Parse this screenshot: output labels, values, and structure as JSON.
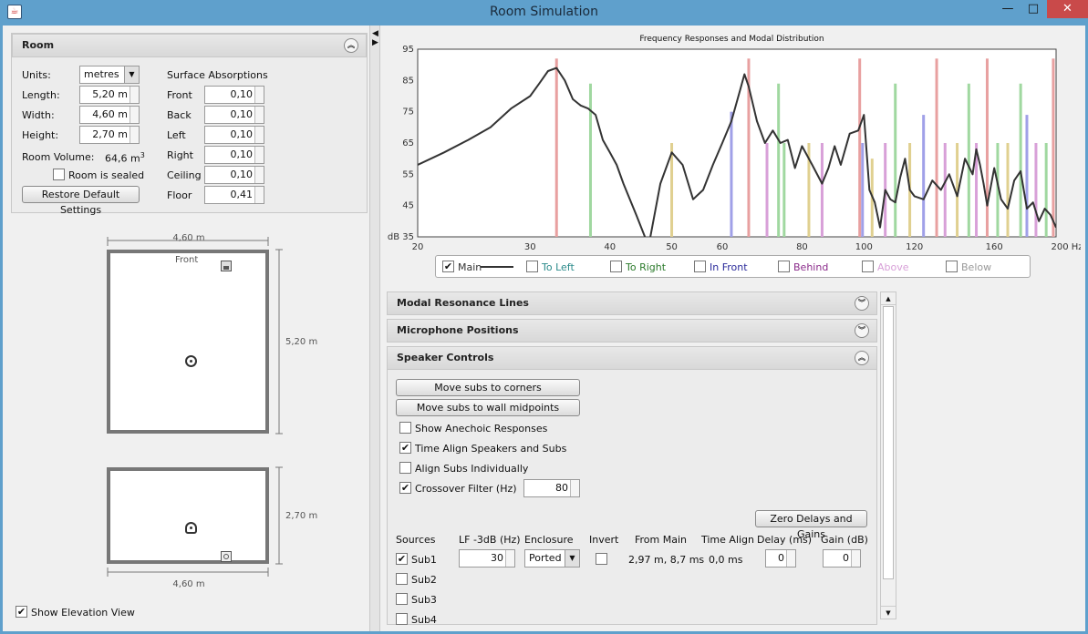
{
  "window": {
    "title": "Room Simulation",
    "minimize": "—",
    "maximize": "□",
    "close": "✕",
    "app_icon": "java-cup-icon"
  },
  "room": {
    "header": "Room",
    "units_label": "Units:",
    "units_value": "metres",
    "length_label": "Length:",
    "length_value": "5,20 m",
    "width_label": "Width:",
    "width_value": "4,60 m",
    "height_label": "Height:",
    "height_value": "2,70 m",
    "volume_label": "Room Volume:",
    "volume_value": "64,6 m",
    "volume_unit_sup": "3",
    "sealed_label": "Room is sealed",
    "sealed_checked": false,
    "restore_button": "Restore Default Settings",
    "surface_title": "Surface Absorptions",
    "surfaces": [
      {
        "label": "Front",
        "value": "0,10"
      },
      {
        "label": "Back",
        "value": "0,10"
      },
      {
        "label": "Left",
        "value": "0,10"
      },
      {
        "label": "Right",
        "value": "0,10"
      },
      {
        "label": "Ceiling",
        "value": "0,10"
      },
      {
        "label": "Floor",
        "value": "0,41"
      }
    ]
  },
  "plan": {
    "top_width": "4,60 m",
    "front_label": "Front",
    "depth": "5,20 m",
    "height": "2,70 m",
    "bottom_width": "4,60 m"
  },
  "show_elevation": {
    "label": "Show Elevation View",
    "checked": true
  },
  "chart_data": {
    "type": "line",
    "title": "Frequency Responses and Modal Distribution",
    "xlabel": "Hz",
    "ylabel": "dB",
    "x_scale": "log",
    "xlim": [
      20,
      200
    ],
    "ylim": [
      35,
      95
    ],
    "x_ticks": [
      20,
      30,
      40,
      50,
      60,
      80,
      100,
      120,
      160,
      200
    ],
    "x_tick_labels": [
      "20",
      "30",
      "40",
      "50",
      "60",
      "80",
      "100",
      "120",
      "160",
      "200 Hz"
    ],
    "y_ticks": [
      35,
      45,
      55,
      65,
      75,
      85,
      95
    ],
    "y_tick_labels": [
      "dB 35",
      "45",
      "55",
      "65",
      "75",
      "85",
      "95"
    ],
    "series": [
      {
        "name": "Main",
        "color": "#333333",
        "x": [
          20,
          22,
          24,
          26,
          28,
          30,
          31,
          32,
          33,
          34,
          35,
          36,
          37,
          38,
          39,
          40,
          41,
          42,
          44,
          46,
          48,
          50,
          52,
          54,
          56,
          58,
          60,
          62,
          64,
          65,
          66,
          68,
          70,
          72,
          74,
          76,
          78,
          80,
          83,
          86,
          88,
          90,
          92,
          95,
          98,
          100,
          102,
          104,
          106,
          108,
          110,
          112,
          114,
          116,
          118,
          120,
          124,
          128,
          132,
          136,
          140,
          144,
          148,
          150,
          152,
          154,
          156,
          160,
          164,
          168,
          172,
          176,
          180,
          184,
          188,
          192,
          196,
          200
        ],
        "y": [
          58,
          62,
          66,
          70,
          76,
          80,
          84,
          88,
          89,
          85,
          79,
          77,
          76,
          74,
          66,
          62,
          58,
          52,
          42,
          32,
          52,
          62,
          58,
          47,
          50,
          58,
          65,
          72,
          82,
          87,
          83,
          72,
          65,
          69,
          65,
          66,
          57,
          64,
          58,
          52,
          57,
          64,
          58,
          68,
          69,
          74,
          50,
          46,
          38,
          50,
          47,
          46,
          54,
          60,
          50,
          48,
          47,
          53,
          50,
          55,
          48,
          60,
          55,
          63,
          58,
          52,
          45,
          57,
          47,
          44,
          53,
          56,
          44,
          46,
          40,
          44,
          42,
          38
        ]
      }
    ],
    "modal_lines": [
      {
        "freq": 33,
        "level": 92,
        "group": "To Left",
        "color": "#e8a0a0"
      },
      {
        "freq": 37.3,
        "level": 84,
        "group": "To Right",
        "color": "#a0d8a0"
      },
      {
        "freq": 50,
        "level": 65,
        "group": "Above",
        "color": "#e0d090"
      },
      {
        "freq": 62,
        "level": 75,
        "group": "In Front",
        "color": "#a0a0e8"
      },
      {
        "freq": 66,
        "level": 92,
        "group": "To Left",
        "color": "#e8a0a0"
      },
      {
        "freq": 70.5,
        "level": 65,
        "group": "Behind",
        "color": "#d8a0d8"
      },
      {
        "freq": 73.5,
        "level": 84,
        "group": "To Right",
        "color": "#a0d8a0"
      },
      {
        "freq": 75,
        "level": 65,
        "group": "To Right",
        "color": "#a0d8a0"
      },
      {
        "freq": 82,
        "level": 65,
        "group": "Above",
        "color": "#e0d090"
      },
      {
        "freq": 86,
        "level": 65,
        "group": "Behind",
        "color": "#d8a0d8"
      },
      {
        "freq": 98.5,
        "level": 92,
        "group": "To Left",
        "color": "#e8a0a0"
      },
      {
        "freq": 99.5,
        "level": 65,
        "group": "In Front",
        "color": "#a0a0e8"
      },
      {
        "freq": 103,
        "level": 60,
        "group": "Above",
        "color": "#e0d090"
      },
      {
        "freq": 108,
        "level": 65,
        "group": "Behind",
        "color": "#d8a0d8"
      },
      {
        "freq": 112,
        "level": 84,
        "group": "To Right",
        "color": "#a0d8a0"
      },
      {
        "freq": 118,
        "level": 65,
        "group": "Above",
        "color": "#e0d090"
      },
      {
        "freq": 124,
        "level": 74,
        "group": "In Front",
        "color": "#a0a0e8"
      },
      {
        "freq": 130,
        "level": 92,
        "group": "To Left",
        "color": "#e8a0a0"
      },
      {
        "freq": 134,
        "level": 65,
        "group": "Behind",
        "color": "#d8a0d8"
      },
      {
        "freq": 140,
        "level": 65,
        "group": "Above",
        "color": "#e0d090"
      },
      {
        "freq": 146,
        "level": 84,
        "group": "To Right",
        "color": "#a0d8a0"
      },
      {
        "freq": 150,
        "level": 65,
        "group": "Behind",
        "color": "#d8a0d8"
      },
      {
        "freq": 156,
        "level": 92,
        "group": "To Left",
        "color": "#e8a0a0"
      },
      {
        "freq": 162,
        "level": 65,
        "group": "To Right",
        "color": "#a0d8a0"
      },
      {
        "freq": 168,
        "level": 65,
        "group": "Above",
        "color": "#e0d090"
      },
      {
        "freq": 176,
        "level": 84,
        "group": "To Right",
        "color": "#a0d8a0"
      },
      {
        "freq": 180,
        "level": 74,
        "group": "In Front",
        "color": "#a0a0e8"
      },
      {
        "freq": 186,
        "level": 65,
        "group": "Behind",
        "color": "#d8a0d8"
      },
      {
        "freq": 193,
        "level": 65,
        "group": "To Right",
        "color": "#a0d8a0"
      },
      {
        "freq": 198,
        "level": 92,
        "group": "To Left",
        "color": "#e8a0a0"
      }
    ]
  },
  "legend": [
    {
      "label": "Main",
      "checked": true,
      "color": "#333333"
    },
    {
      "label": "To Left",
      "checked": false,
      "color": "#2a8a8a"
    },
    {
      "label": "To Right",
      "checked": false,
      "color": "#2a7a2a"
    },
    {
      "label": "In Front",
      "checked": false,
      "color": "#2a2a9a"
    },
    {
      "label": "Behind",
      "checked": false,
      "color": "#8a2a8a"
    },
    {
      "label": "Above",
      "checked": false,
      "color": "#d8a0d8"
    },
    {
      "label": "Below",
      "checked": false,
      "color": "#999999"
    }
  ],
  "sections": {
    "modal": "Modal Resonance Lines",
    "mics": "Microphone Positions",
    "speakers": "Speaker Controls"
  },
  "speakers": {
    "move_corners": "Move subs to corners",
    "move_mid": "Move subs to wall midpoints",
    "anechoic": {
      "label": "Show Anechoic Responses",
      "checked": false
    },
    "time_align": {
      "label": "Time Align Speakers and Subs",
      "checked": true
    },
    "align_individually": {
      "label": "Align Subs Individually",
      "checked": false
    },
    "crossover": {
      "label": "Crossover Filter (Hz)",
      "checked": true,
      "value": "80"
    },
    "zero_button": "Zero Delays and Gains",
    "columns": [
      "Sources",
      "LF -3dB (Hz)",
      "Enclosure",
      "Invert",
      "From Main",
      "Time Align",
      "Delay (ms)",
      "Gain (dB)"
    ],
    "sub1": {
      "label": "Sub1",
      "checked": true,
      "lf": "30",
      "enclosure": "Ported",
      "invert": false,
      "from_main": "2,97 m, 8,7 ms",
      "time_align": "0,0 ms",
      "delay": "0",
      "gain": "0"
    },
    "sub2": {
      "label": "Sub2",
      "checked": false
    },
    "sub3": {
      "label": "Sub3",
      "checked": false
    },
    "sub4": {
      "label": "Sub4",
      "checked": false
    }
  }
}
